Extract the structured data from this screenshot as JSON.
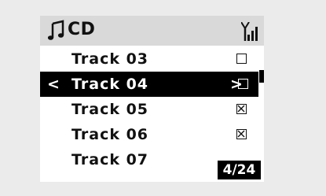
{
  "header": {
    "title": "CD",
    "icon": "music-note-icon",
    "status_icon": "signal-strength-icon"
  },
  "tracks": [
    {
      "label": "Track 03",
      "checked": false,
      "selected": false
    },
    {
      "label": "Track 04",
      "checked": false,
      "selected": true
    },
    {
      "label": "Track 05",
      "checked": true,
      "selected": false
    },
    {
      "label": "Track 06",
      "checked": true,
      "selected": false
    },
    {
      "label": "Track 07",
      "checked": false,
      "selected": false
    }
  ],
  "selection": {
    "left_arrow": "<",
    "right_arrow": ">"
  },
  "counter": "4/24",
  "colors": {
    "background": "#ebebeb",
    "header": "#d9d9d9",
    "highlight": "#000000",
    "text": "#111111"
  }
}
